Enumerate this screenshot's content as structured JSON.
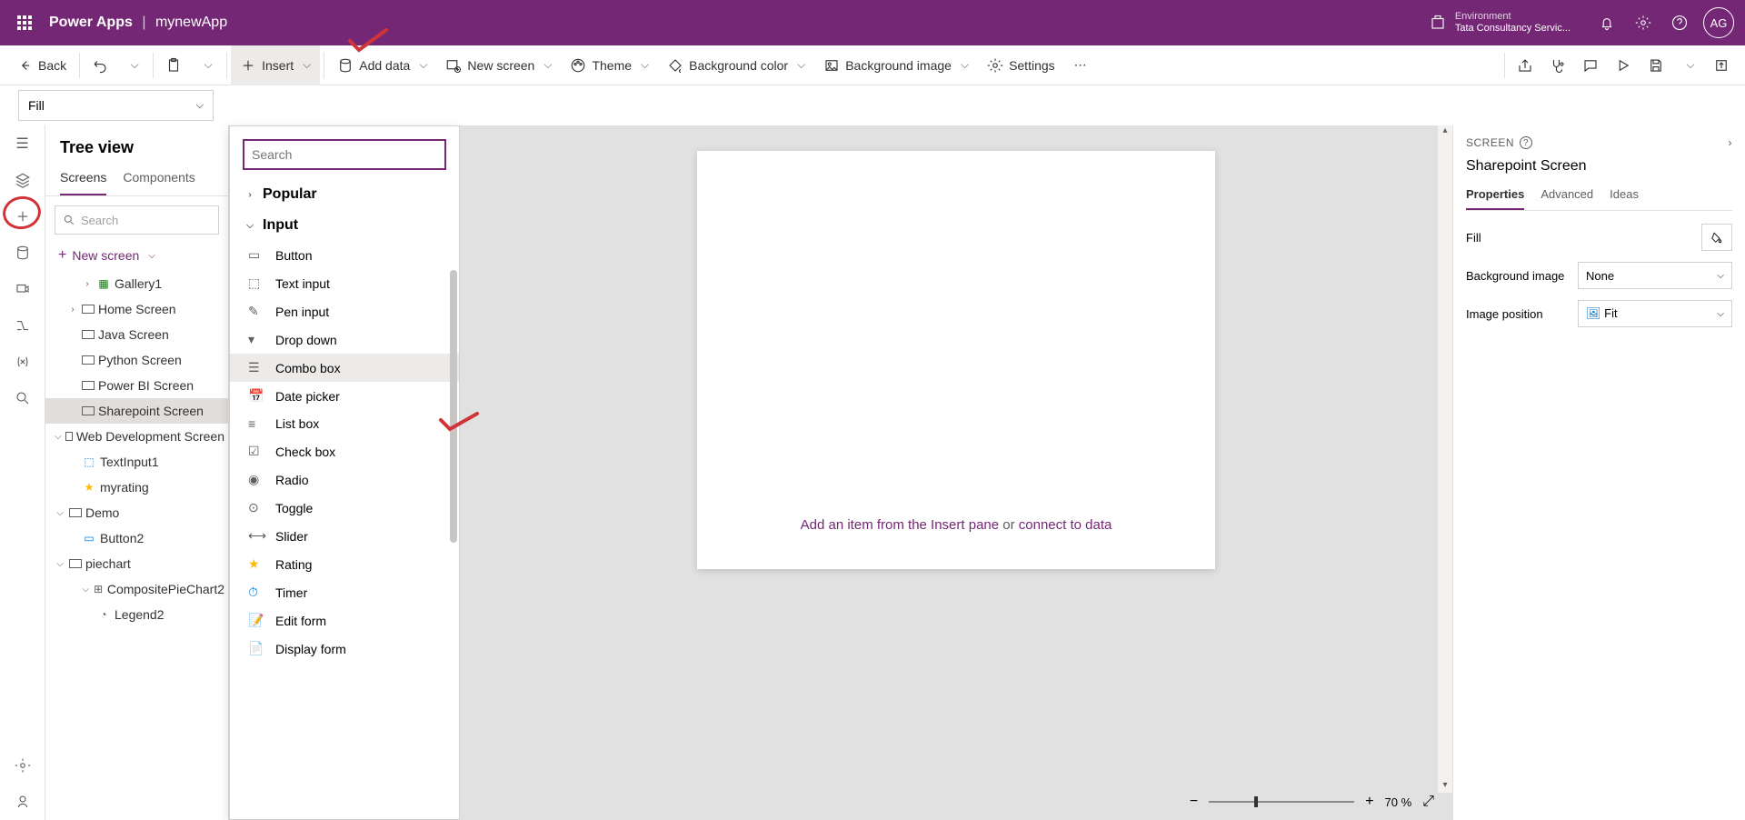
{
  "header": {
    "product": "Power Apps",
    "app_name": "mynewApp",
    "env_label": "Environment",
    "env_name": "Tata Consultancy Servic...",
    "avatar": "AG"
  },
  "cmd": {
    "back": "Back",
    "insert": "Insert",
    "add_data": "Add data",
    "new_screen": "New screen",
    "theme": "Theme",
    "bg_color": "Background color",
    "bg_image": "Background image",
    "settings": "Settings"
  },
  "formula": {
    "property": "Fill"
  },
  "tree": {
    "title": "Tree view",
    "tab_screens": "Screens",
    "tab_components": "Components",
    "search_ph": "Search",
    "new_screen": "New screen",
    "items": {
      "gallery1": "Gallery1",
      "home": "Home Screen",
      "java": "Java Screen",
      "python": "Python Screen",
      "powerbi": "Power BI Screen",
      "sharepoint": "Sharepoint Screen",
      "webdev": "Web Development Screen",
      "textinput1": "TextInput1",
      "myrating": "myrating",
      "demo": "Demo",
      "button2": "Button2",
      "piechart": "piechart",
      "comppie": "CompositePieChart2",
      "legend2": "Legend2"
    }
  },
  "insert": {
    "search_ph": "Search",
    "group_popular": "Popular",
    "group_input": "Input",
    "items": {
      "button": "Button",
      "textinput": "Text input",
      "peninput": "Pen input",
      "dropdown": "Drop down",
      "combobox": "Combo box",
      "datepicker": "Date picker",
      "listbox": "List box",
      "checkbox": "Check box",
      "radio": "Radio",
      "toggle": "Toggle",
      "slider": "Slider",
      "rating": "Rating",
      "timer": "Timer",
      "editform": "Edit form",
      "displayform": "Display form"
    }
  },
  "canvas": {
    "hint_pre": "Add an item from the Insert pane",
    "hint_or": " or ",
    "hint_link": "connect to data",
    "zoom": "70  %"
  },
  "props": {
    "label": "SCREEN",
    "name": "Sharepoint Screen",
    "tab_props": "Properties",
    "tab_adv": "Advanced",
    "tab_ideas": "Ideas",
    "fill": "Fill",
    "bgimg": "Background image",
    "bgimg_val": "None",
    "imgpos": "Image position",
    "imgpos_val": "Fit"
  }
}
